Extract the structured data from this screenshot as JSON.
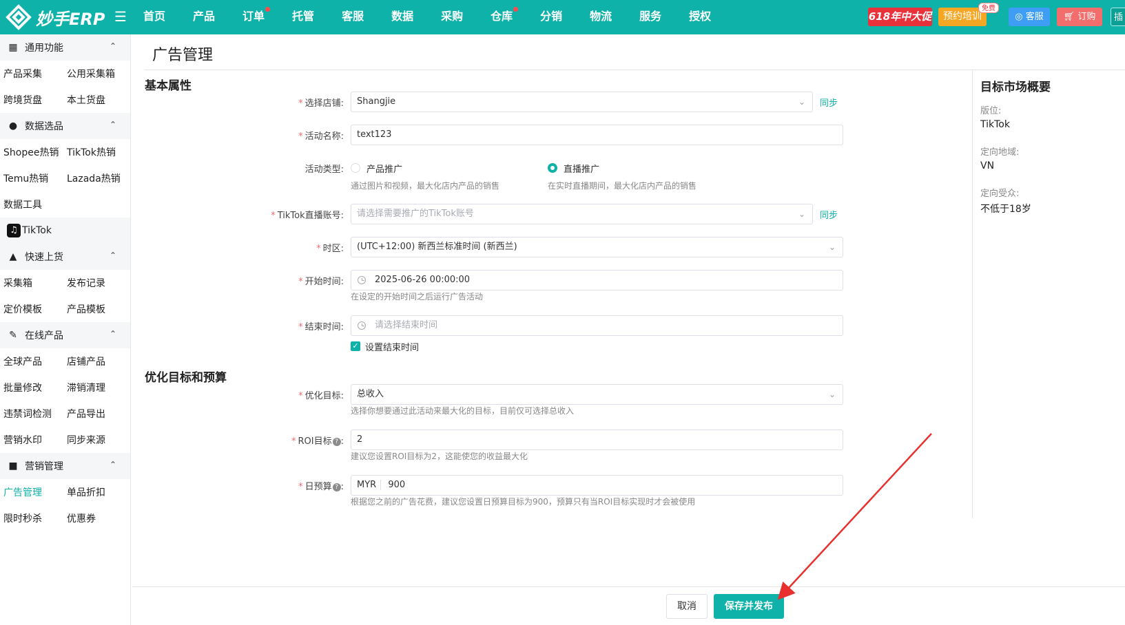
{
  "app": {
    "logo_text": "妙手ERP",
    "nav": [
      {
        "label": "首页",
        "dot": false
      },
      {
        "label": "产品",
        "dot": false
      },
      {
        "label": "订单",
        "dot": true
      },
      {
        "label": "托管",
        "dot": false
      },
      {
        "label": "客服",
        "dot": false
      },
      {
        "label": "数据",
        "dot": false
      },
      {
        "label": "采购",
        "dot": false
      },
      {
        "label": "仓库",
        "dot": true
      },
      {
        "label": "分销",
        "dot": false
      },
      {
        "label": "物流",
        "dot": false
      },
      {
        "label": "服务",
        "dot": false
      },
      {
        "label": "授权",
        "dot": false
      }
    ],
    "promos": {
      "sale": "618年中大促",
      "training": "预约培训",
      "free_badge": "免费",
      "service": "客服",
      "order": "订购",
      "plugin": "插"
    }
  },
  "sidebar": {
    "sections": [
      {
        "title": "通用功能",
        "icon": "grid-icon",
        "rows": [
          [
            "产品采集",
            "公用采集箱"
          ],
          [
            "跨境货盘",
            "本土货盘"
          ]
        ]
      },
      {
        "title": "数据选品",
        "icon": "fire-icon",
        "rows": [
          [
            "Shopee热销",
            "TikTok热销"
          ],
          [
            "Temu热销",
            "Lazada热销"
          ],
          [
            "数据工具",
            ""
          ]
        ]
      },
      {
        "title": "快速上货",
        "icon": "bag-icon",
        "rows": [
          [
            "采集箱",
            "发布记录"
          ],
          [
            "定价模板",
            "产品模板"
          ]
        ]
      },
      {
        "title": "在线产品",
        "icon": "edit-icon",
        "rows": [
          [
            "全球产品",
            "店铺产品"
          ],
          [
            "批量修改",
            "滞销清理"
          ],
          [
            "违禁词检测",
            "产品导出"
          ],
          [
            "营销水印",
            "同步来源"
          ]
        ]
      },
      {
        "title": "营销管理",
        "icon": "marketing-icon",
        "rows": [
          [
            "广告管理",
            "单品折扣"
          ],
          [
            "限时秒杀",
            "优惠券"
          ]
        ]
      }
    ],
    "tiktok_label": "TikTok",
    "active_item": "广告管理"
  },
  "page": {
    "title": "广告管理",
    "basic_section": "基本属性",
    "optimize_section": "优化目标和预算",
    "store": {
      "label": "选择店铺:",
      "value": "Shangjie",
      "sync": "同步"
    },
    "campaign_name": {
      "label": "活动名称:",
      "value": "text123"
    },
    "campaign_type": {
      "label": "活动类型:",
      "options": [
        {
          "label": "产品推广",
          "desc": "通过图片和视频，最大化店内产品的销售",
          "selected": false
        },
        {
          "label": "直播推广",
          "desc": "在实时直播期间，最大化店内产品的销售",
          "selected": true
        }
      ]
    },
    "tiktok_account": {
      "label": "TikTok直播账号:",
      "placeholder": "请选择需要推广的TikTok账号",
      "sync": "同步"
    },
    "timezone": {
      "label": "时区:",
      "value": "(UTC+12:00) 新西兰标准时间 (新西兰)"
    },
    "start_time": {
      "label": "开始时间:",
      "value": "2025-06-26 00:00:00",
      "hint": "在设定的开始时间之后运行广告活动"
    },
    "end_time": {
      "label": "结束时间:",
      "placeholder": "请选择结束时间",
      "checkbox_label": "设置结束时间",
      "checked": true
    },
    "goal": {
      "label": "优化目标:",
      "value": "总收入",
      "hint": "选择你想要通过此活动来最大化的目标，目前仅可选择总收入"
    },
    "roi": {
      "label": "ROI目标",
      "value": "2",
      "hint": "建议您设置ROI目标为2，这能使您的收益最大化"
    },
    "budget": {
      "label": "日预算",
      "currency": "MYR",
      "value": "900",
      "hint": "根据您之前的广告花费，建议您设置日预算目标为900，预算只有当ROI目标实现时才会被使用"
    }
  },
  "market_overview": {
    "title": "目标市场概要",
    "placement_label": "版位:",
    "placement_value": "TikTok",
    "region_label": "定向地域:",
    "region_value": "VN",
    "audience_label": "定向受众:",
    "audience_value": "不低于18岁"
  },
  "footer": {
    "cancel": "取消",
    "save": "保存并发布"
  },
  "colors": {
    "primary": "#0fb2a9",
    "required": "#f56c6c",
    "arrow": "#e8312f"
  }
}
